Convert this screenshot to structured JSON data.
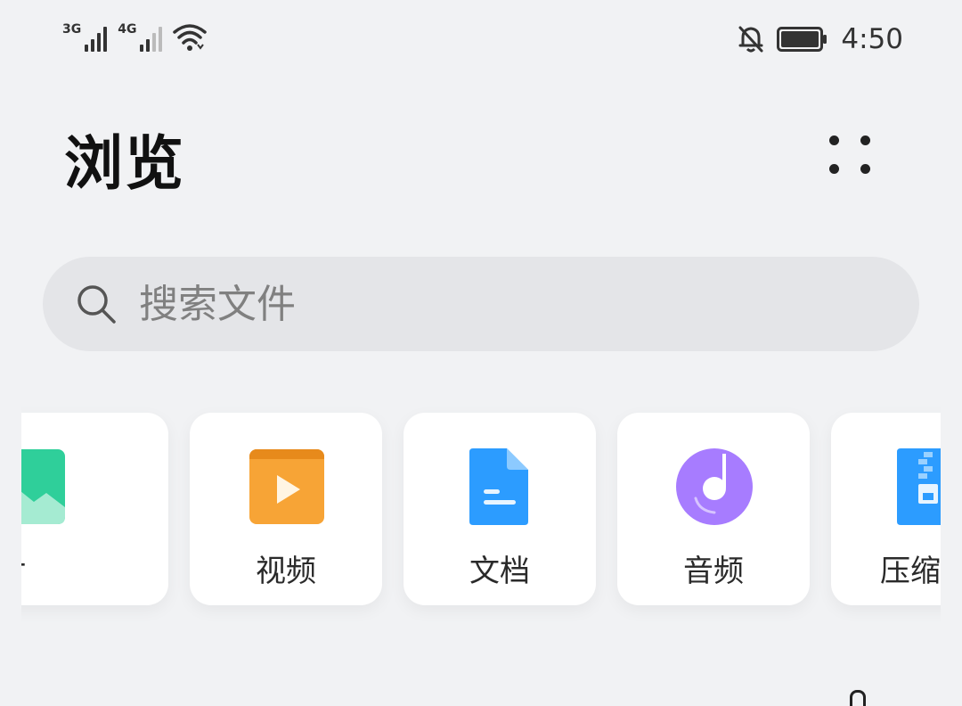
{
  "status_bar": {
    "network1": "3G",
    "network2": "4G",
    "time": "4:50",
    "icons": [
      "signal-icon",
      "wifi-icon",
      "notifications-off-icon",
      "battery-icon"
    ]
  },
  "header": {
    "title": "浏览",
    "more_icon": "more-icon"
  },
  "search": {
    "placeholder": "搜索文件",
    "icon": "search-icon"
  },
  "categories": [
    {
      "label": "图片",
      "icon": "image-icon",
      "color": "#2fcf9a"
    },
    {
      "label": "视频",
      "icon": "video-icon",
      "color": "#f7a436"
    },
    {
      "label": "文档",
      "icon": "document-icon",
      "color": "#2c9cff"
    },
    {
      "label": "音频",
      "icon": "audio-icon",
      "color": "#a77cff"
    },
    {
      "label": "压缩",
      "icon": "archive-icon",
      "color": "#2c9cff"
    }
  ]
}
